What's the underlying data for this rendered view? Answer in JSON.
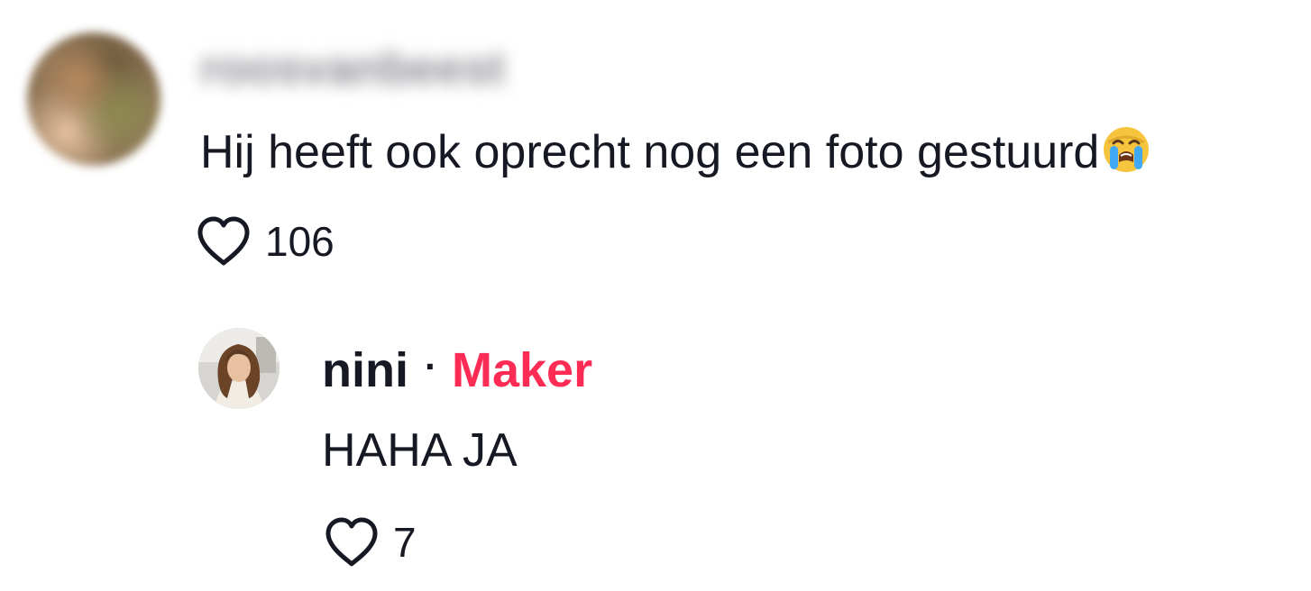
{
  "comment": {
    "username": "roosvanbeest",
    "text": "Hij heeft ook oprecht nog een foto gestuurd",
    "emoji": "loudly-crying-face",
    "likes": "106"
  },
  "reply": {
    "username": "nini",
    "separator": "·",
    "badge": "Maker",
    "text": "HAHA JA",
    "likes": "7"
  },
  "colors": {
    "text": "#161823",
    "accent": "#fe2c55"
  },
  "icons": {
    "like": "heart-outline-icon"
  }
}
